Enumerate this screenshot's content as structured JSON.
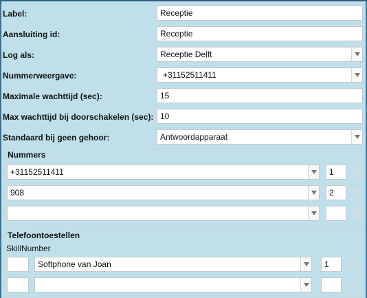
{
  "form": {
    "label": {
      "label": "Label:",
      "value": "Receptie"
    },
    "connection_id": {
      "label": "Aansluiting id:",
      "value": "Receptie"
    },
    "log_as": {
      "label": "Log als:",
      "value": "Receptie Delft"
    },
    "number_display": {
      "label": "Nummerweergave:",
      "value": "+31152511411"
    },
    "max_wait": {
      "label": "Maximale wachttijd (sec):",
      "value": "15"
    },
    "max_wait_forward": {
      "label": "Max wachttijd bij doorschakelen (sec):",
      "value": "10"
    },
    "default_no_answer": {
      "label": "Standaard bij geen gehoor:",
      "value": "Antwoordapparaat"
    }
  },
  "numbers": {
    "title": "Nummers",
    "rows": [
      {
        "number": "+31152511411",
        "order": "1"
      },
      {
        "number": "908",
        "order": "2"
      },
      {
        "number": "",
        "order": ""
      }
    ]
  },
  "phones": {
    "title": "Telefoontoestellen",
    "header": "SkillNumber",
    "rows": [
      {
        "skill": "",
        "device": "Softphone van Joan",
        "order": "1"
      },
      {
        "skill": "",
        "device": "",
        "order": ""
      }
    ]
  },
  "icons": {
    "dropdown": "chevron-down-icon",
    "delete": "trash-icon"
  }
}
